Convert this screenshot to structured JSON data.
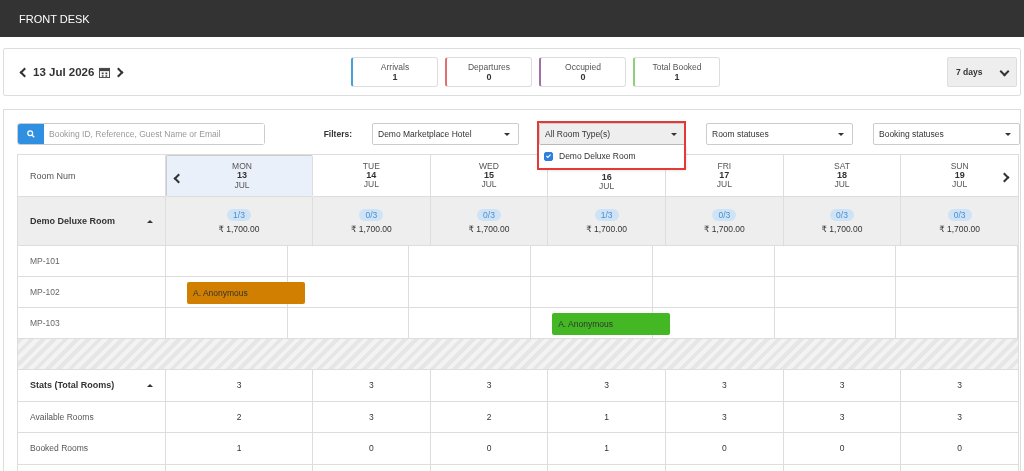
{
  "header": {
    "title": "FRONT DESK"
  },
  "toolbar": {
    "date": "13 Jul 2026",
    "counters": [
      {
        "label": "Arrivals",
        "value": "1",
        "color": "#4a9fd5"
      },
      {
        "label": "Departures",
        "value": "0",
        "color": "#e07070"
      },
      {
        "label": "Occupied",
        "value": "0",
        "color": "#a070a8"
      },
      {
        "label": "Total Booked",
        "value": "1",
        "color": "#8fcf7a"
      }
    ],
    "range": "7 days"
  },
  "search": {
    "placeholder": "Booking ID, Reference, Guest Name or Email"
  },
  "filters": {
    "label": "Filters:",
    "selects": [
      {
        "value": "Demo Marketplace Hotel",
        "expanded": false
      },
      {
        "value": "All Room Type(s)",
        "expanded": true,
        "options": [
          {
            "label": "Demo Deluxe Room",
            "checked": true
          }
        ]
      },
      {
        "value": "Room statuses",
        "expanded": false
      },
      {
        "value": "Booking statuses",
        "expanded": false
      }
    ]
  },
  "calendar": {
    "room_header": "Room Num",
    "days": [
      {
        "day": "MON",
        "date": "13",
        "month": "JUL",
        "selected": true
      },
      {
        "day": "TUE",
        "date": "14",
        "month": "JUL",
        "selected": false
      },
      {
        "day": "WED",
        "date": "15",
        "month": "JUL",
        "selected": false
      },
      {
        "date": "16",
        "month": "JUL",
        "selected": false
      },
      {
        "day": "FRI",
        "date": "17",
        "month": "JUL",
        "selected": false
      },
      {
        "day": "SAT",
        "date": "18",
        "month": "JUL",
        "selected": false
      },
      {
        "day": "SUN",
        "date": "19",
        "month": "JUL",
        "selected": false
      }
    ],
    "room_types": [
      {
        "name": "Demo Deluxe Room",
        "expanded": true,
        "availability": [
          {
            "count": "1/3",
            "price": "₹ 1,700.00"
          },
          {
            "count": "0/3",
            "price": "₹ 1,700.00"
          },
          {
            "count": "0/3",
            "price": "₹ 1,700.00"
          },
          {
            "count": "1/3",
            "price": "₹ 1,700.00"
          },
          {
            "count": "0/3",
            "price": "₹ 1,700.00"
          },
          {
            "count": "0/3",
            "price": "₹ 1,700.00"
          },
          {
            "count": "0/3",
            "price": "₹ 1,700.00"
          }
        ],
        "rooms": [
          {
            "room": "MP-101",
            "cells": [
              null,
              null,
              null,
              null,
              null,
              null,
              null
            ]
          },
          {
            "room": "MP-102",
            "cells": [
              {
                "guest": "A. Anonymous",
                "color": "#d17f00"
              },
              null,
              null,
              null,
              null,
              null,
              null
            ]
          },
          {
            "room": "MP-103",
            "cells": [
              null,
              null,
              null,
              {
                "guest": "A. Anonymous",
                "color": "#44b824"
              },
              null,
              null,
              null
            ]
          }
        ]
      }
    ],
    "stats": {
      "title": "Stats (Total Rooms)",
      "expanded": true,
      "values": [
        "3",
        "3",
        "3",
        "3",
        "3",
        "3",
        "3"
      ],
      "rows": [
        {
          "label": "Available Rooms",
          "values": [
            "2",
            "3",
            "2",
            "1",
            "3",
            "3",
            "3"
          ]
        },
        {
          "label": "Booked Rooms",
          "values": [
            "1",
            "0",
            "0",
            "1",
            "0",
            "0",
            "0"
          ]
        }
      ]
    }
  }
}
